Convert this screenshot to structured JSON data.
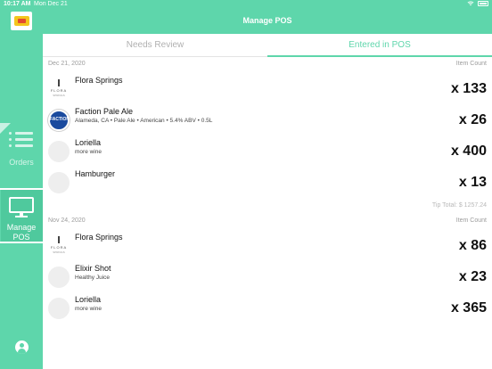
{
  "status_bar": {
    "time": "10:17 AM",
    "date": "Mon Dec 21"
  },
  "header": {
    "title": "Manage POS"
  },
  "sidebar": {
    "items": [
      {
        "label": "Orders",
        "icon": "list-icon"
      },
      {
        "label": "Manage POS",
        "icon": "monitor-icon",
        "active": true
      }
    ]
  },
  "tabs": [
    {
      "label": "Needs Review",
      "active": false
    },
    {
      "label": "Entered in POS",
      "active": true
    }
  ],
  "sections": [
    {
      "date": "Dec 21, 2020",
      "count_label": "Item Count",
      "items": [
        {
          "name": "Flora Springs",
          "sub": "",
          "qty": "x 133",
          "thumb": "flora"
        },
        {
          "name": "Faction Pale Ale",
          "sub": "Alameda, CA • Pale Ale • American • 5.4% ABV • 0.5L",
          "qty": "x 26",
          "thumb": "faction"
        },
        {
          "name": "Loriella",
          "sub": "more wine",
          "qty": "x 400",
          "thumb": "blank"
        },
        {
          "name": "Hamburger",
          "sub": "",
          "qty": "x 13",
          "thumb": "blank"
        }
      ],
      "tip_total": "Tip Total: $ 1257.24"
    },
    {
      "date": "Nov 24, 2020",
      "count_label": "Item Count",
      "items": [
        {
          "name": "Flora Springs",
          "sub": "",
          "qty": "x 86",
          "thumb": "flora"
        },
        {
          "name": "Elixir Shot",
          "sub": "Healthy Juice",
          "qty": "x 23",
          "thumb": "blank"
        },
        {
          "name": "Loriella",
          "sub": "more wine",
          "qty": "x 365",
          "thumb": "blank"
        }
      ]
    }
  ],
  "thumb_text": {
    "flora_mark": "FLORA",
    "flora_sub": "SPRINGS",
    "faction": "FACTION"
  },
  "colors": {
    "accent": "#5ed6ab",
    "text": "#111111",
    "muted": "#9c9c9c"
  }
}
